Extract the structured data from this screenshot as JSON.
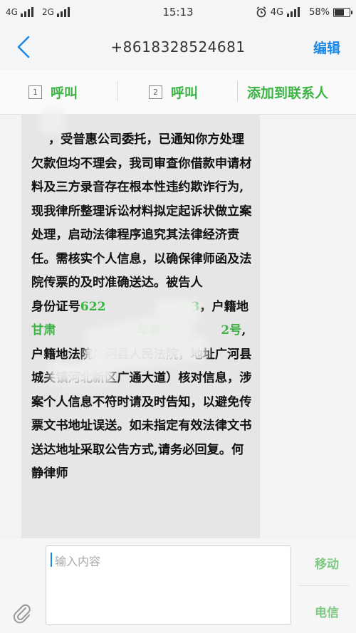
{
  "status_bar": {
    "sim1": "4G",
    "sim2": "2G",
    "time": "15:13",
    "network": "4G",
    "battery": "58%",
    "battery_level": 0.58
  },
  "header": {
    "title": "+8618328524681",
    "edit_label": "编辑"
  },
  "actions": {
    "call1_sim": "1",
    "call1_label": "呼叫",
    "call2_sim": "2",
    "call2_label": "呼叫",
    "add_contact_label": "添加到联系人"
  },
  "message": {
    "part1": "    ，受普惠公司委托，已通知你方处理欠款但均不理会，我司审查你借款申请材料及三方录音存在根本性违约欺诈行为,现我律所整理诉讼材料拟定起诉状做立案处理，启动法律程序追究其法律经济责任。需核实个人信息，以确保律师函及法院传票的及时准确送达。被告人            身份证号",
    "id_number": "622                    3",
    "part2": "，户籍地",
    "address_link": "甘肃                   车家              2号",
    "part3": ",户籍地法院广河县人民法院，地址广河县城关镇河北新区广通大道）核对信息，涉案个人信息不符时请及时告知，以避免传票文书地址误送。如未指定有效法律文书送达地址采取公告方式,请务必回复。何静律师"
  },
  "composer": {
    "placeholder": "输入内容",
    "send_mobile": "移动",
    "send_telecom": "电信"
  }
}
